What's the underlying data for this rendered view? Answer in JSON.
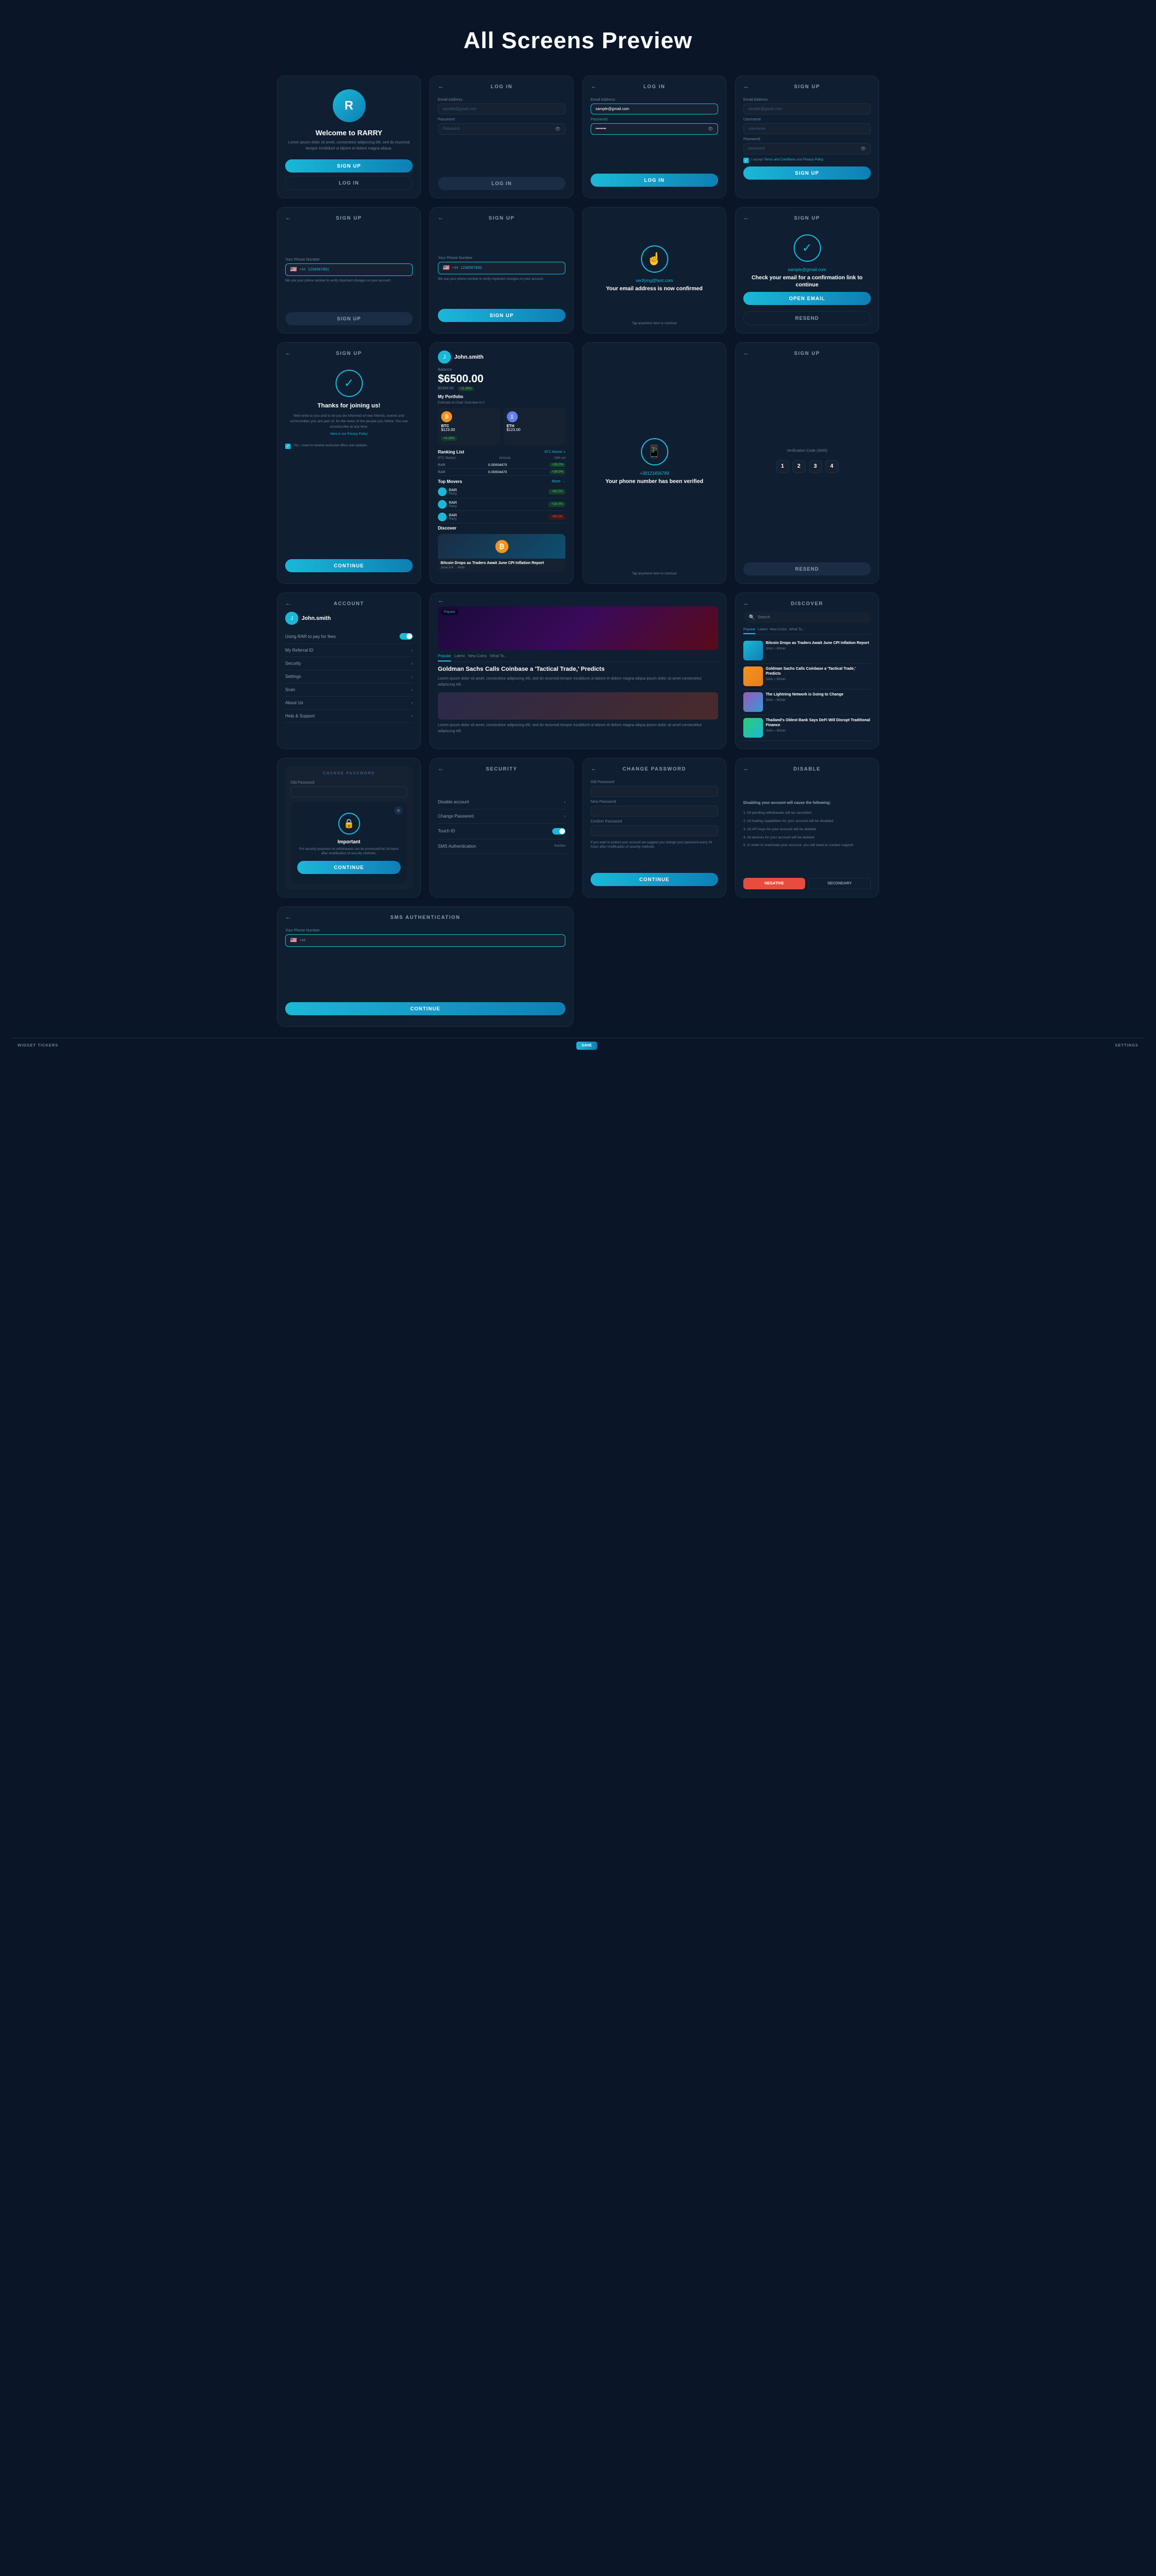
{
  "page": {
    "title": "All Screens Preview"
  },
  "screens": {
    "welcome": {
      "logo_initials": "R",
      "title": "Welcome to RARRY",
      "description": "Lorem ipsum dolor sit amet, consectetur adipiscing elit, sed do eiusmod tempor incididunt ut labore et dolore magna aliqua.",
      "signup_label": "SIGN UP",
      "login_label": "LOG IN"
    },
    "login1": {
      "header": "LOG IN",
      "email_label": "Email Address",
      "email_placeholder": "sample@gmail.com",
      "password_label": "Password",
      "password_placeholder": "Password",
      "login_btn": "LOG IN"
    },
    "login2": {
      "header": "LOG IN",
      "email_label": "Email Address",
      "email_value": "sample@gmail.com",
      "password_label": "Password",
      "password_value": "••••••••",
      "login_btn": "LOG IN"
    },
    "signup1": {
      "header": "SIGN UP",
      "email_label": "Email Address",
      "email_placeholder": "sample@gmail.com",
      "username_label": "Username",
      "username_placeholder": "username",
      "password_label": "Password",
      "password_placeholder": "password",
      "terms_text": "I accept Terms and Conditions and Privacy Policy",
      "signup_btn": "SIGN UP"
    },
    "signup_phone1": {
      "header": "SIGN UP",
      "phone_label": "Your Phone Number",
      "flag": "🇺🇸",
      "code": "+44",
      "phone_value": "1234567891",
      "hint": "We use your phone number to verify important changes on your account.",
      "signup_btn": "SIGN UP"
    },
    "signup_phone2": {
      "header": "SIGN UP",
      "phone_label": "Your Phone Number",
      "flag": "🇺🇸",
      "code": "+44",
      "phone_value": "1234567893",
      "hint": "We use your phone number to verify important changes on your account.",
      "signup_btn": "SIGN UP"
    },
    "email_confirm": {
      "email": "verifying@test.com",
      "title": "Your email address is now confirmed",
      "tap_hint": "Tap anywhere here to continue"
    },
    "check_email": {
      "header": "SIGN UP",
      "email": "sample@gmail.com",
      "title": "Check your email for a confirmation link to continue",
      "open_email_btn": "OPEN EMAIL",
      "resend_btn": "RESEND"
    },
    "thanks": {
      "header": "SIGN UP",
      "title": "Thanks for joining us!",
      "description": "Well write to you and to let you be informed of new friends, events and communities you are part of, for the news of the people you follow. You can unsubscribe at any time.",
      "privacy_label": "Here is our Privacy Policy",
      "checkbox_text": "Yes, I want to receive exclusive offers and updates.",
      "continue_btn": "CONTINUE"
    },
    "dashboard": {
      "user": "John.smith",
      "balance_label": "Balance",
      "balance": "$6500.00",
      "balance_sub": "$2456.00",
      "badge_up": "+1.19%",
      "portfolio_title": "My Portfolio",
      "portfolio_hint": "Estimate At Chart Overview In #",
      "btc_name": "BTC",
      "btc_val": "$123.00",
      "btc_badge": "+4.19%",
      "eth_name": "ETH",
      "eth_val": "$123.00",
      "ranking_title": "Ranking List",
      "ranking_filter": "BTC Market ∨",
      "cols": [
        "BTC Market",
        "Amount",
        "24H volume"
      ],
      "rows": [
        {
          "name": "RAR",
          "val": "0.00004470",
          "badge": "+26.0%"
        },
        {
          "name": "RAR",
          "val": "0.00004470",
          "badge": "+26.0%"
        }
      ],
      "movers_title": "Top Movers",
      "movers_more": "More →",
      "movers": [
        {
          "name": "RAR",
          "badge": "+40.0%",
          "type": "up"
        },
        {
          "name": "RAR",
          "badge": "+18.0%",
          "type": "up"
        },
        {
          "name": "RAR",
          "badge": "+45.0%",
          "type": "down"
        }
      ],
      "discover_title": "Discover",
      "news_title": "Bitcoin Drops as Traders Await June CPI Inflation Report",
      "news_date": "June 5-6",
      "news_read": "6min"
    },
    "phone_verified": {
      "phone": "+38123456789",
      "title": "Your phone number has been verified",
      "tap_hint": "Tap anywhere here to continue"
    },
    "otp": {
      "header": "SIGN UP",
      "label": "Verification Code (SMS)",
      "digits": [
        "1",
        "2",
        "3",
        "4"
      ],
      "resend_btn": "RESEND"
    },
    "account": {
      "header": "ACCOUNT",
      "user": "John.smith",
      "items": [
        {
          "label": "Using RAR to pay for fees",
          "type": "toggle"
        },
        {
          "label": "My Referral ID",
          "type": "arrow"
        },
        {
          "label": "Security",
          "type": "arrow"
        },
        {
          "label": "Settings",
          "type": "arrow"
        },
        {
          "label": "Scan",
          "type": "arrow"
        },
        {
          "label": "About Us",
          "type": "arrow"
        },
        {
          "label": "Help & Support",
          "type": "arrow"
        }
      ]
    },
    "article": {
      "header": "Popular",
      "tabs": [
        "Popular",
        "Latest",
        "New Coins",
        "What To..."
      ],
      "title": "Goldman Sachs Calls Coinbase a 'Tactical Trade,' Predicts",
      "description": "Lorem ipsum dolor sit amet, consectetur adipiscing elit, sed do eiusmod tempor incididunt ut labore et dolore magna aliqua ipsum dolor sit amet consectetur adipiscing elit.",
      "description2": "Lorem ipsum dolor sit amet, consectetur adipiscing elit, sed do eiusmod tempor incididunt ut labore et dolore magna aliqua ipsum dolor sit amet consectetur adipiscing elit."
    },
    "discover_right": {
      "header": "DISCOVER",
      "search_placeholder": "Search",
      "tabs": [
        "Popular",
        "Latest",
        "New Coins",
        "What To..."
      ],
      "news": [
        {
          "title": "Bitcoin Drops as Traders Await June CPI Inflation Report",
          "meta": "3min ○ 60min",
          "thumb": "blue"
        },
        {
          "title": "Goldman Sachs Calls Coinbase a 'Tactical Trade,' Predicts",
          "meta": "3min ○ 60min",
          "thumb": "orange"
        },
        {
          "title": "The Lightning Network is Going to Change",
          "meta": "3min ○ 60min",
          "thumb": "purple"
        },
        {
          "title": "Thailand's Oldest Bank Says DeFi Will Disrupt Traditional Finance",
          "meta": "3min ○ 60min",
          "thumb": "green"
        }
      ]
    },
    "security": {
      "header": "SECURITY",
      "items": [
        {
          "label": "Disable account",
          "type": "arrow"
        },
        {
          "label": "Change Password",
          "type": "arrow"
        },
        {
          "label": "Touch ID",
          "type": "toggle"
        },
        {
          "label": "SMS Authentication",
          "type": "toggle_off"
        }
      ]
    },
    "change_password": {
      "header": "CHANGE PASSWORD",
      "old_label": "Old Password",
      "new_label": "New Password",
      "confirm_label": "Confirm Password",
      "hint": "If you want to protect your account we suggest you change your password every 24 hours after modification of security methods.",
      "continue_btn": "CONTINUE"
    },
    "change_password_modal": {
      "title": "Important",
      "description": "For security purposes no withdrawals can be processed for 24 hours after modification of security methods.",
      "continue_btn": "CONTINUE"
    },
    "disable": {
      "header": "DISABLE",
      "title": "Disabling your account will cause the following:",
      "list": [
        "1. All pending withdrawals will be cancelled.",
        "2. All trading capabilities for your account will be disabled.",
        "3. All API keys for your account will be deleted.",
        "4. All devices for your account will be deleted.",
        "5. In order to reactivate your account, you will need to contact support."
      ],
      "negative_btn": "NEGATIVE",
      "secondary_btn": "SECONDARY"
    },
    "sms_auth": {
      "header": "SMS AUTHENTICATION",
      "phone_label": "Your Phone Number",
      "flag": "🇺🇸",
      "code": "+44",
      "continue_btn": "CONTINUE"
    }
  },
  "bottom_bar": {
    "widget_label": "WIDGET TICKERS",
    "save_label": "SAVE",
    "settings_label": "SETTINGS"
  }
}
